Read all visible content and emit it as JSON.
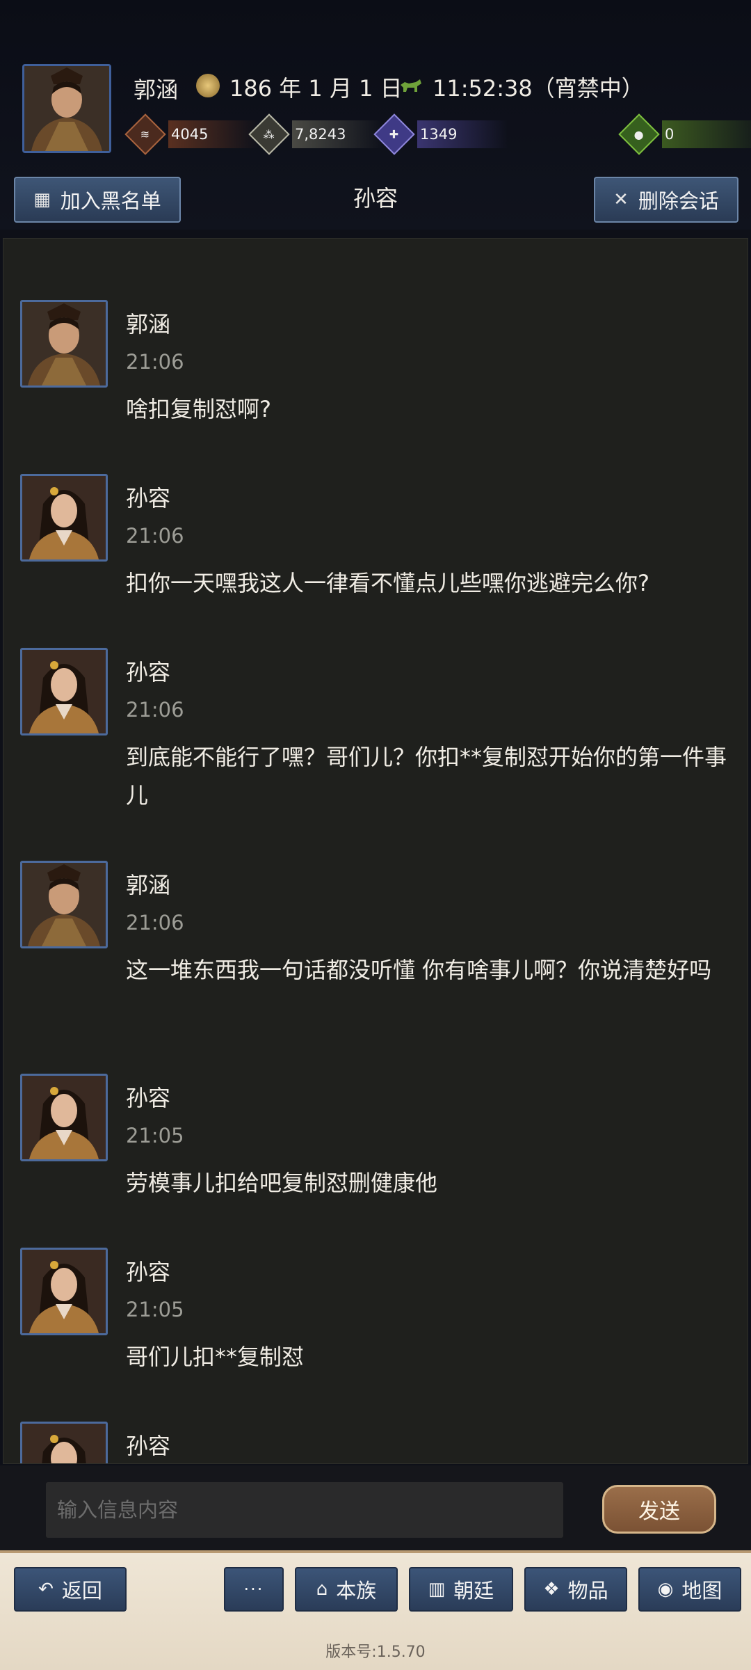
{
  "header": {
    "player_name": "郭涵",
    "date": "186 年 1 月 1 日",
    "time": "11:52:38（宵禁中）",
    "stats": {
      "money": "4045",
      "food": "7,8243",
      "troops": "1349",
      "bag": "0"
    },
    "blacklist_label": "加入黑名单",
    "chat_title": "孙容",
    "delete_label": "删除会话"
  },
  "messages": [
    {
      "name": "郭涵",
      "time": "21:06",
      "text": "啥扣复制怼啊?",
      "avatar": "male"
    },
    {
      "name": "孙容",
      "time": "21:06",
      "text": "扣你一天嘿我这人一律看不懂点儿些嘿你逃避完么你?",
      "avatar": "female"
    },
    {
      "name": "孙容",
      "time": "21:06",
      "text": "到底能不能行了嘿？哥们儿？你扣**复制怼开始你的第一件事儿",
      "avatar": "female"
    },
    {
      "name": "郭涵",
      "time": "21:06",
      "text": "这一堆东西我一句话都没听懂 你有啥事儿啊？你说清楚好吗",
      "avatar": "male"
    },
    {
      "name": "孙容",
      "time": "21:05",
      "text": "劳模事儿扣给吧复制怼删健康他",
      "avatar": "female"
    },
    {
      "name": "孙容",
      "time": "21:05",
      "text": "哥们儿扣**复制怼",
      "avatar": "female"
    },
    {
      "name": "孙容",
      "time": "",
      "text": "",
      "avatar": "female"
    }
  ],
  "input": {
    "placeholder": "输入信息内容",
    "send_label": "发送"
  },
  "bottom_nav": {
    "back": "返回",
    "more": "···",
    "clan": "本族",
    "court": "朝廷",
    "items": "物品",
    "map": "地图"
  },
  "version": "版本号:1.5.70"
}
